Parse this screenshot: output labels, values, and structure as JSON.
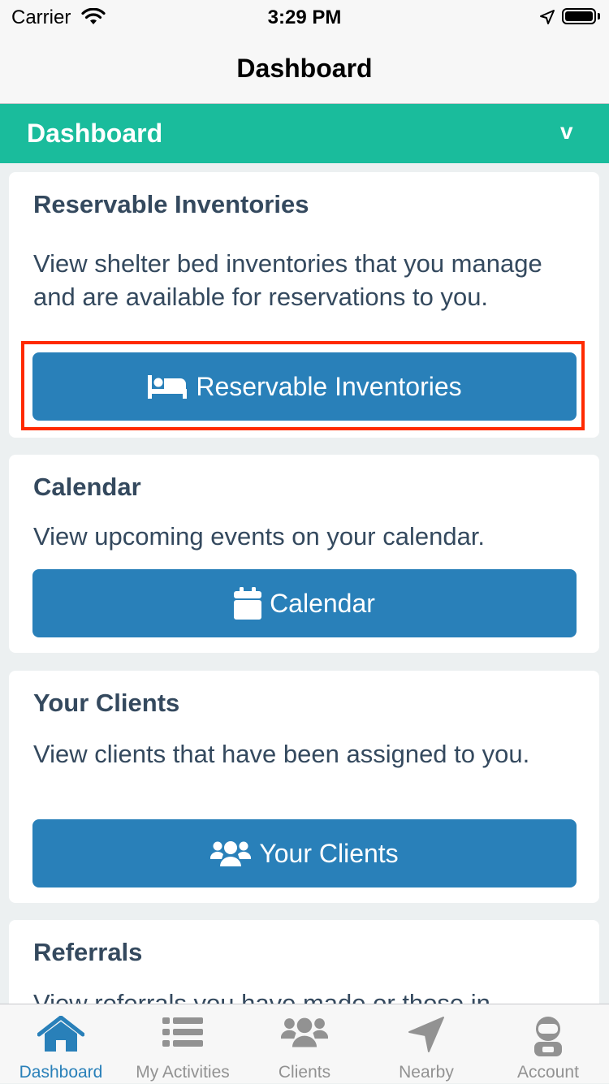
{
  "status_bar": {
    "carrier": "Carrier",
    "time": "3:29 PM"
  },
  "nav": {
    "title": "Dashboard"
  },
  "section": {
    "title": "Dashboard",
    "toggle": "v"
  },
  "cards": [
    {
      "title": "Reservable Inventories",
      "description": "View shelter bed inventories that you manage and are available for reservations to you.",
      "button_label": "Reservable Inventories",
      "button_icon": "bed-icon"
    },
    {
      "title": "Calendar",
      "description": "View upcoming events on your calendar.",
      "button_label": "Calendar",
      "button_icon": "calendar-icon"
    },
    {
      "title": "Your Clients",
      "description": "View clients that have been assigned to you.",
      "button_label": "Your Clients",
      "button_icon": "users-icon"
    },
    {
      "title": "Referrals",
      "description": "View referrals you have made or those in"
    }
  ],
  "tabs": [
    {
      "label": "Dashboard",
      "icon": "home-icon",
      "active": true
    },
    {
      "label": "My Activities",
      "icon": "list-icon"
    },
    {
      "label": "Clients",
      "icon": "users-icon"
    },
    {
      "label": "Nearby",
      "icon": "location-arrow-icon"
    },
    {
      "label": "Account",
      "icon": "astronaut-icon"
    }
  ],
  "colors": {
    "accent_green": "#1ABC9C",
    "button_blue": "#2980B9",
    "text_dark": "#34495E",
    "highlight_red": "#FF2A00",
    "tab_inactive": "#929292"
  }
}
